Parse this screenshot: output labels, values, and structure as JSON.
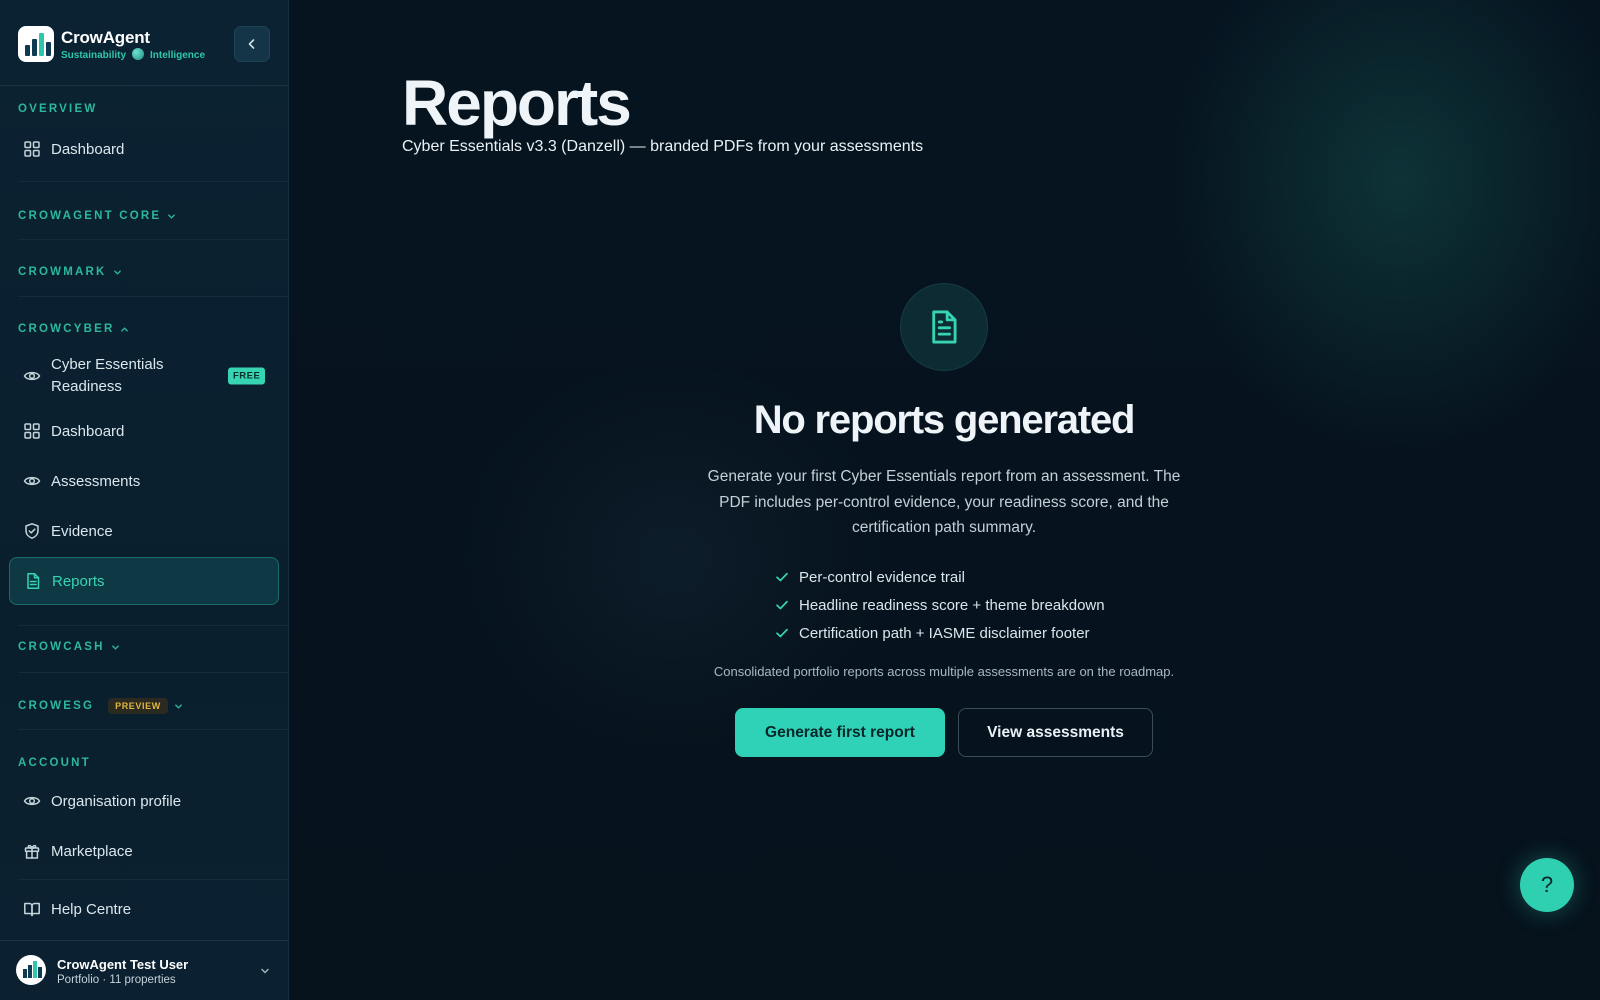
{
  "brand": {
    "name": "CrowAgent",
    "tag_left": "Sustainability",
    "tag_right": "Intelligence"
  },
  "sidebar": {
    "sections": {
      "overview": "OVERVIEW",
      "core": "CROWAGENT CORE",
      "mark": "CROWMARK",
      "cyber": "CROWCYBER",
      "cash": "CROWCASH",
      "esg": "CROWESG",
      "esg_badge": "PREVIEW",
      "account": "ACCOUNT"
    },
    "items": {
      "overview_dashboard": "Dashboard",
      "cyber_readiness": "Cyber Essentials Readiness",
      "cyber_readiness_badge": "FREE",
      "cyber_dashboard": "Dashboard",
      "assessments": "Assessments",
      "evidence": "Evidence",
      "reports": "Reports",
      "org_profile": "Organisation profile",
      "marketplace": "Marketplace",
      "help_centre": "Help Centre"
    },
    "active_item": "reports"
  },
  "user": {
    "name": "CrowAgent Test User",
    "subtitle": "Portfolio · 11 properties"
  },
  "main": {
    "title": "Reports",
    "subtitle": "Cyber Essentials v3.3 (Danzell) — branded PDFs from your assessments",
    "empty_state": {
      "icon": "file-text-icon",
      "title": "No reports generated",
      "description": "Generate your first Cyber Essentials report from an assessment. The PDF includes per-control evidence, your readiness score, and the certification path summary.",
      "features": [
        "Per-control evidence trail",
        "Headline readiness score + theme breakdown",
        "Certification path + IASME disclaimer footer"
      ],
      "note": "Consolidated portfolio reports across multiple assessments are on the roadmap.",
      "primary_button": "Generate first report",
      "secondary_button": "View assessments"
    },
    "help_button": "?"
  },
  "colors": {
    "accent": "#2fd2b6",
    "section_heading": "#2db79f",
    "background": "#06121d",
    "sidebar": "#0a1f2e",
    "preview_badge": "#e1b640"
  }
}
